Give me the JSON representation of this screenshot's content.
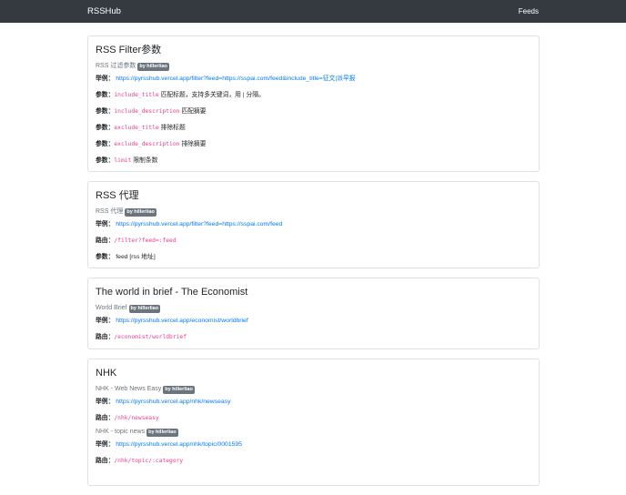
{
  "navbar": {
    "brand": "RSSHub",
    "feeds": "Feeds"
  },
  "cards": [
    {
      "title": "RSS Filter参数",
      "routes": [
        {
          "subtitle": "RSS 过滤参数",
          "badge": "by hillerliao",
          "example_label": "举例：",
          "example_url": "https://pyrsshub.vercel.app/filter?feed=https://sspai.com/feed&include_title=征文|派早报",
          "params": [
            {
              "label": "参数：",
              "code": "include_title",
              "desc": "匹配标题，支持多关键词，用 | 分隔。"
            },
            {
              "label": "参数：",
              "code": "include_description",
              "desc": "匹配摘要"
            },
            {
              "label": "参数：",
              "code": "exclude_title",
              "desc": "排除标题"
            },
            {
              "label": "参数：",
              "code": "exclude_description",
              "desc": "排除摘要"
            },
            {
              "label": "参数：",
              "code": "limit",
              "desc": "限制条数"
            }
          ]
        }
      ]
    },
    {
      "title": "RSS 代理",
      "routes": [
        {
          "subtitle": "RSS 代理",
          "badge": "by hillerliao",
          "example_label": "举例：",
          "example_url": "https://pyrsshub.vercel.app/filter?feed=https://sspai.com/feed",
          "route_label": "路由：",
          "route_code": "/filter?feed=:feed",
          "param_label": "参数：",
          "param_desc": "feed [rss 地址]"
        }
      ]
    },
    {
      "title": "The world in brief - The Economist",
      "routes": [
        {
          "subtitle": "World Brief",
          "badge": "by hillerliao",
          "example_label": "举例：",
          "example_url": "https://pyrsshub.vercel.app/economist/worldbrief",
          "route_label": "路由：",
          "route_code": "/economist/worldbrief"
        }
      ]
    },
    {
      "title": "NHK",
      "routes": [
        {
          "subtitle": "NHK - Web News Easy",
          "badge": "by hillerliao",
          "example_label": "举例：",
          "example_url": "https://pyrsshub.vercel.app/nhk/newseasy",
          "route_label": "路由：",
          "route_code": "/nhk/newseasy"
        },
        {
          "subtitle": "NHK - topic news",
          "badge": "by hillerliao",
          "example_label": "举例：",
          "example_url": "https://pyrsshub.vercel.app/nhk/topic/0001595",
          "route_label": "路由：",
          "route_code": "/nhk/topic/:category"
        }
      ]
    }
  ]
}
